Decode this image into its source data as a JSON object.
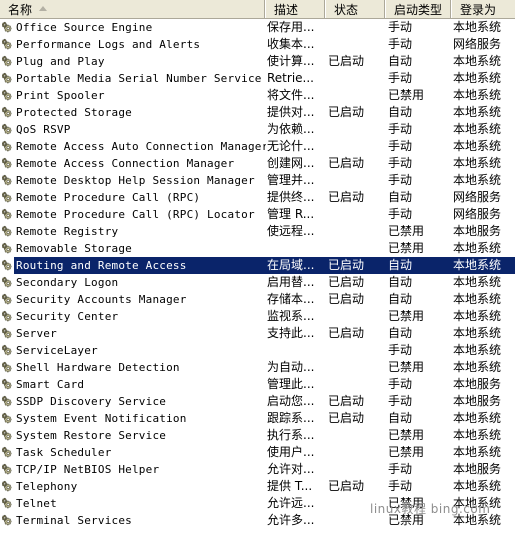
{
  "header": {
    "columns": [
      {
        "key": "name",
        "label": "名称",
        "icon": "sort-ascending-icon"
      },
      {
        "key": "desc",
        "label": "描述"
      },
      {
        "key": "status",
        "label": "状态"
      },
      {
        "key": "start",
        "label": "启动类型"
      },
      {
        "key": "logon",
        "label": "登录为"
      }
    ]
  },
  "colors": {
    "header_bg": "#ece9d8",
    "selection_bg": "#0a246a",
    "selection_fg": "#ffffff",
    "row_bg": "#ffffff",
    "text": "#000000",
    "watermark": "#8e8e8e"
  },
  "watermark": {
    "text": "linux教程  bing.com"
  },
  "list": {
    "icon": "service-gear-icon",
    "selected_index": 14,
    "rows": [
      {
        "name": "Office Source Engine",
        "desc": "保存用...",
        "status": "",
        "start": "手动",
        "logon": "本地系统"
      },
      {
        "name": "Performance Logs and Alerts",
        "desc": "收集本...",
        "status": "",
        "start": "手动",
        "logon": "网络服务"
      },
      {
        "name": "Plug and Play",
        "desc": "使计算...",
        "status": "已启动",
        "start": "自动",
        "logon": "本地系统"
      },
      {
        "name": "Portable Media Serial Number Service",
        "desc": "Retrie...",
        "status": "",
        "start": "手动",
        "logon": "本地系统"
      },
      {
        "name": "Print Spooler",
        "desc": "将文件...",
        "status": "",
        "start": "已禁用",
        "logon": "本地系统"
      },
      {
        "name": "Protected Storage",
        "desc": "提供对...",
        "status": "已启动",
        "start": "自动",
        "logon": "本地系统"
      },
      {
        "name": "QoS RSVP",
        "desc": "为依赖...",
        "status": "",
        "start": "手动",
        "logon": "本地系统"
      },
      {
        "name": "Remote Access Auto Connection Manager",
        "desc": "无论什...",
        "status": "",
        "start": "手动",
        "logon": "本地系统"
      },
      {
        "name": "Remote Access Connection Manager",
        "desc": "创建网...",
        "status": "已启动",
        "start": "手动",
        "logon": "本地系统"
      },
      {
        "name": "Remote Desktop Help Session Manager",
        "desc": "管理并...",
        "status": "",
        "start": "手动",
        "logon": "本地系统"
      },
      {
        "name": "Remote Procedure Call (RPC)",
        "desc": "提供终...",
        "status": "已启动",
        "start": "自动",
        "logon": "网络服务"
      },
      {
        "name": "Remote Procedure Call (RPC) Locator",
        "desc": "管理 R...",
        "status": "",
        "start": "手动",
        "logon": "网络服务"
      },
      {
        "name": "Remote Registry",
        "desc": "使远程...",
        "status": "",
        "start": "已禁用",
        "logon": "本地服务"
      },
      {
        "name": "Removable Storage",
        "desc": "",
        "status": "",
        "start": "已禁用",
        "logon": "本地系统"
      },
      {
        "name": "Routing and Remote Access",
        "desc": "在局域...",
        "status": "已启动",
        "start": "自动",
        "logon": "本地系统"
      },
      {
        "name": "Secondary Logon",
        "desc": "启用替...",
        "status": "已启动",
        "start": "自动",
        "logon": "本地系统"
      },
      {
        "name": "Security Accounts Manager",
        "desc": "存储本...",
        "status": "已启动",
        "start": "自动",
        "logon": "本地系统"
      },
      {
        "name": "Security Center",
        "desc": "监视系...",
        "status": "",
        "start": "已禁用",
        "logon": "本地系统"
      },
      {
        "name": "Server",
        "desc": "支持此...",
        "status": "已启动",
        "start": "自动",
        "logon": "本地系统"
      },
      {
        "name": "ServiceLayer",
        "desc": "",
        "status": "",
        "start": "手动",
        "logon": "本地系统"
      },
      {
        "name": "Shell Hardware Detection",
        "desc": "为自动...",
        "status": "",
        "start": "已禁用",
        "logon": "本地系统"
      },
      {
        "name": "Smart Card",
        "desc": "管理此...",
        "status": "",
        "start": "手动",
        "logon": "本地服务"
      },
      {
        "name": "SSDP Discovery Service",
        "desc": "启动您...",
        "status": "已启动",
        "start": "手动",
        "logon": "本地服务"
      },
      {
        "name": "System Event Notification",
        "desc": "跟踪系...",
        "status": "已启动",
        "start": "自动",
        "logon": "本地系统"
      },
      {
        "name": "System Restore Service",
        "desc": "执行系...",
        "status": "",
        "start": "已禁用",
        "logon": "本地系统"
      },
      {
        "name": "Task Scheduler",
        "desc": "使用户...",
        "status": "",
        "start": "已禁用",
        "logon": "本地系统"
      },
      {
        "name": "TCP/IP NetBIOS Helper",
        "desc": "允许对...",
        "status": "",
        "start": "手动",
        "logon": "本地服务"
      },
      {
        "name": "Telephony",
        "desc": "提供 T...",
        "status": "已启动",
        "start": "手动",
        "logon": "本地系统"
      },
      {
        "name": "Telnet",
        "desc": "允许远...",
        "status": "",
        "start": "已禁用",
        "logon": "本地系统"
      },
      {
        "name": "Terminal Services",
        "desc": "允许多...",
        "status": "",
        "start": "已禁用",
        "logon": "本地系统"
      }
    ]
  }
}
